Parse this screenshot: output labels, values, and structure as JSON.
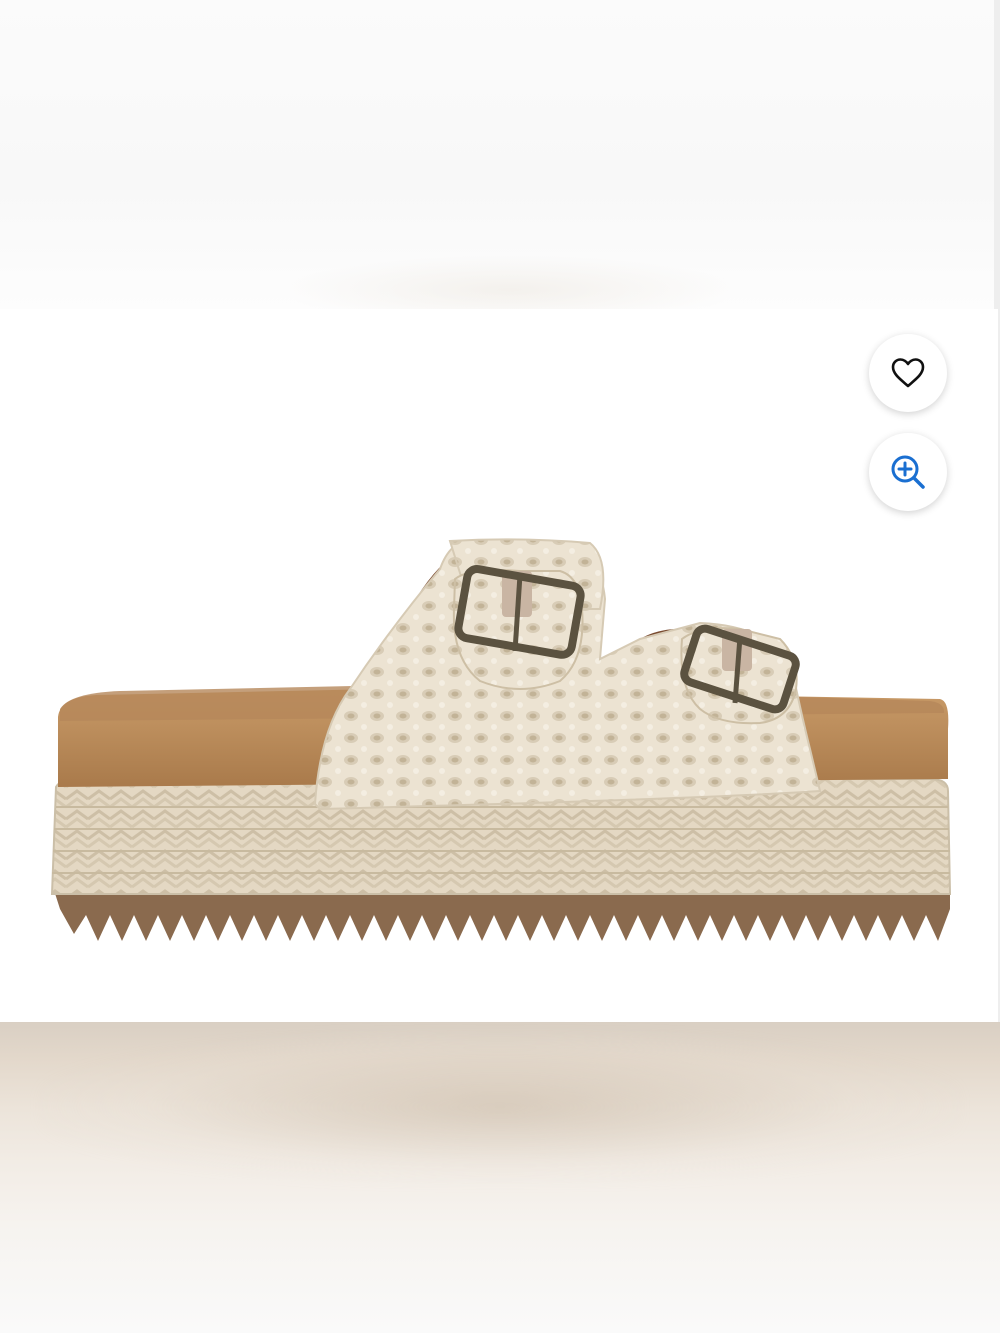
{
  "product_image": {
    "alt": "",
    "colors": {
      "crochet": "#ece3d2",
      "cork": "#b98a5a",
      "jute": "#e4d8c3",
      "sole": "#8a6a4e",
      "buckle": "#5b5240"
    }
  },
  "actions": {
    "wishlist_icon": "heart-outline-icon",
    "zoom_icon": "zoom-in-icon",
    "zoom_accent": "#1a6fd1"
  }
}
